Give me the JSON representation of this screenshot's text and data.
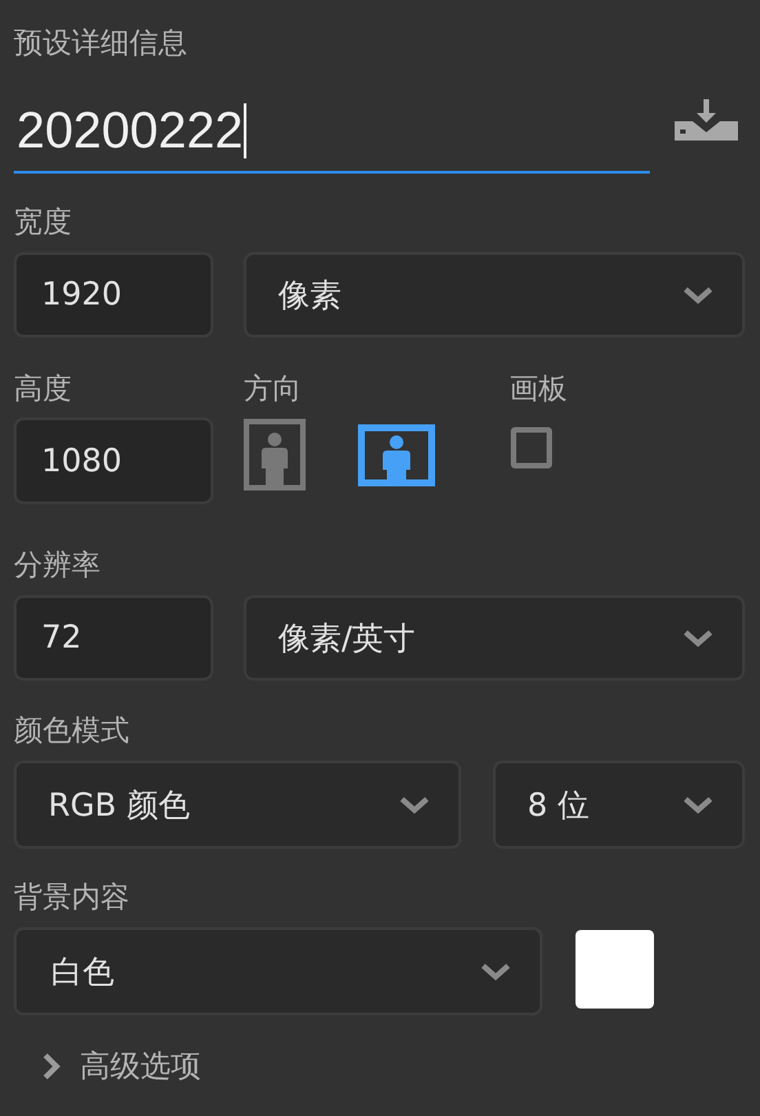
{
  "title": "预设详细信息",
  "preset_name": {
    "value": "20200222"
  },
  "width": {
    "label": "宽度",
    "value": "1920",
    "unit": "像素"
  },
  "height": {
    "label": "高度",
    "value": "1080"
  },
  "orientation": {
    "label": "方向",
    "options": [
      {
        "kind": "portrait",
        "selected": false
      },
      {
        "kind": "landscape",
        "selected": true
      }
    ]
  },
  "artboard": {
    "label": "画板",
    "checked": false
  },
  "resolution": {
    "label": "分辨率",
    "value": "72",
    "unit": "像素/英寸"
  },
  "color_mode": {
    "label": "颜色模式",
    "mode": "RGB 颜色",
    "depth": "8 位"
  },
  "background": {
    "label": "背景内容",
    "value": "白色",
    "color": "#ffffff"
  },
  "advanced": {
    "label": "高级选项",
    "expanded": false
  }
}
